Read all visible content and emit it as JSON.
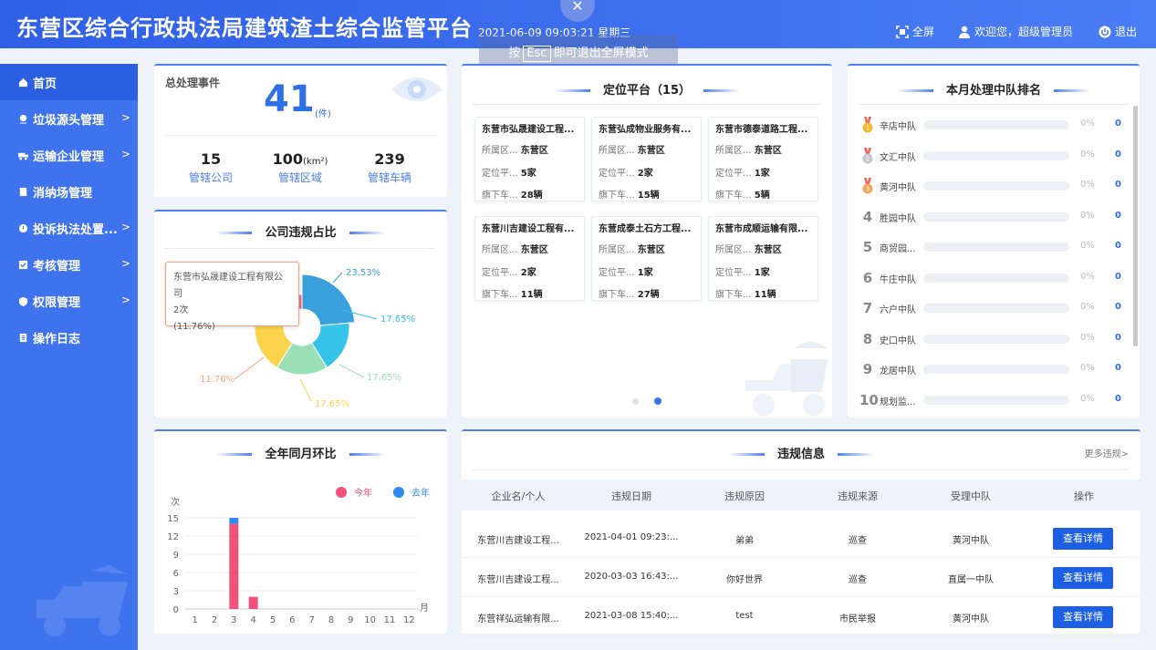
{
  "header": {
    "title": "东营区综合行政执法局建筑渣土综合监管平台",
    "datetime": "2021-06-09   09:03:21   星期三",
    "fullscreen": "全屏",
    "welcome": "欢迎您，超级管理员",
    "logout": "退出",
    "esc_prefix": "按",
    "esc_key": "Esc",
    "esc_suffix": "即可退出全屏模式",
    "close_glyph": "✕"
  },
  "sidebar": {
    "items": [
      {
        "label": "首页",
        "icon": "home-icon",
        "active": true,
        "arrow": false
      },
      {
        "label": "垃圾源头管理",
        "icon": "location-icon",
        "active": false,
        "arrow": true
      },
      {
        "label": "运输企业管理",
        "icon": "truck-icon",
        "active": false,
        "arrow": true
      },
      {
        "label": "消纳场管理",
        "icon": "doc-icon",
        "active": false,
        "arrow": false
      },
      {
        "label": "投诉执法处置...",
        "icon": "alert-icon",
        "active": false,
        "arrow": true
      },
      {
        "label": "考核管理",
        "icon": "check-icon",
        "active": false,
        "arrow": true
      },
      {
        "label": "权限管理",
        "icon": "shield-icon",
        "active": false,
        "arrow": true
      },
      {
        "label": "操作日志",
        "icon": "log-icon",
        "active": false,
        "arrow": false
      }
    ],
    "arrow_glyph": ">"
  },
  "summary": {
    "label": "总处理事件",
    "value": "41",
    "unit": "(件)",
    "stats": [
      {
        "value": "15",
        "unit": "",
        "label": "管辖公司"
      },
      {
        "value": "100",
        "unit": "(km²)",
        "label": "管辖区域"
      },
      {
        "value": "239",
        "unit": "",
        "label": "管辖车辆"
      }
    ]
  },
  "pie": {
    "title": "公司违规占比",
    "tooltip": {
      "name": "东营市弘晟建设工程有限公司",
      "count": "2次",
      "pct": "(11.76%)"
    },
    "labels": [
      "23.53%",
      "17.65%",
      "17.65%",
      "17.65%",
      "11.76%"
    ],
    "colors": [
      "#3aa0db",
      "#36c4e8",
      "#9be0b4",
      "#fcd34d",
      "#fca27e",
      "#f26d85"
    ]
  },
  "chart_data": {
    "type": "rose-pie",
    "title": "公司违规占比",
    "values": [
      23.53,
      17.65,
      17.65,
      17.65,
      11.76,
      11.76
    ]
  },
  "chart_data_bar": {
    "type": "bar",
    "title": "全年同月环比",
    "ylabel": "次",
    "xlabel": "月",
    "categories": [
      "1",
      "2",
      "3",
      "4",
      "5",
      "6",
      "7",
      "8",
      "9",
      "10",
      "11",
      "12"
    ],
    "ylim": [
      0,
      15
    ],
    "yticks": [
      "15",
      "12",
      "9",
      "6",
      "3",
      "0"
    ],
    "series": [
      {
        "name": "今年",
        "color": "#f0527a",
        "values": [
          0,
          0,
          14,
          2,
          0,
          0,
          0,
          0,
          0,
          0,
          0,
          0
        ]
      },
      {
        "name": "去年",
        "color": "#2f8bf0",
        "values": [
          0,
          0,
          1,
          0,
          0,
          0,
          0,
          0,
          0,
          0,
          0,
          0
        ]
      }
    ]
  },
  "location": {
    "title": "定位平台（15）",
    "companies": [
      {
        "name": "东营市弘晟建设工程...",
        "area": "东营区",
        "point": "5家",
        "vehicle": "28辆"
      },
      {
        "name": "东营弘成物业服务有...",
        "area": "东营区",
        "point": "2家",
        "vehicle": "15辆"
      },
      {
        "name": "东营市德泰道路工程...",
        "area": "东营区",
        "point": "1家",
        "vehicle": "5辆"
      },
      {
        "name": "东营川吉建设工程有...",
        "area": "东营区",
        "point": "2家",
        "vehicle": "11辆"
      },
      {
        "name": "东营成泰土石方工程...",
        "area": "东营区",
        "point": "1家",
        "vehicle": "27辆"
      },
      {
        "name": "东营市成顺运输有限...",
        "area": "东营区",
        "point": "1家",
        "vehicle": "11辆"
      }
    ],
    "labels": {
      "area": "所属区...",
      "point": "定位平...",
      "vehicle": "旗下车..."
    }
  },
  "ranking": {
    "title": "本月处理中队排名",
    "items": [
      {
        "rank": "1",
        "name": "辛店中队",
        "pct": "0%",
        "count": "0"
      },
      {
        "rank": "2",
        "name": "文汇中队",
        "pct": "0%",
        "count": "0"
      },
      {
        "rank": "3",
        "name": "黄河中队",
        "pct": "0%",
        "count": "0"
      },
      {
        "rank": "4",
        "name": "胜园中队",
        "pct": "0%",
        "count": "0"
      },
      {
        "rank": "5",
        "name": "商贸园...",
        "pct": "0%",
        "count": "0"
      },
      {
        "rank": "6",
        "name": "牛庄中队",
        "pct": "0%",
        "count": "0"
      },
      {
        "rank": "7",
        "name": "六户中队",
        "pct": "0%",
        "count": "0"
      },
      {
        "rank": "8",
        "name": "史口中队",
        "pct": "0%",
        "count": "0"
      },
      {
        "rank": "9",
        "name": "龙居中队",
        "pct": "0%",
        "count": "0"
      },
      {
        "rank": "10",
        "name": "规划监...",
        "pct": "0%",
        "count": "0"
      }
    ]
  },
  "violations": {
    "title": "违规信息",
    "more": "更多违规>",
    "headers": [
      "企业名/个人",
      "违规日期",
      "违规原因",
      "违规来源",
      "受理中队",
      "操作"
    ],
    "rows": [
      [
        "东营川吉建设工程...",
        "2021-04-01 09:23:...",
        "弟弟",
        "巡查",
        "黄河中队",
        "查看详情"
      ],
      [
        "东营川吉建设工程...",
        "2020-03-03 16:43:...",
        "你好世界",
        "巡查",
        "直属一中队",
        "查看详情"
      ],
      [
        "东营祥弘运输有限...",
        "2021-03-08 15:40:...",
        "test",
        "市民举报",
        "黄河中队",
        "查看详情"
      ]
    ]
  }
}
